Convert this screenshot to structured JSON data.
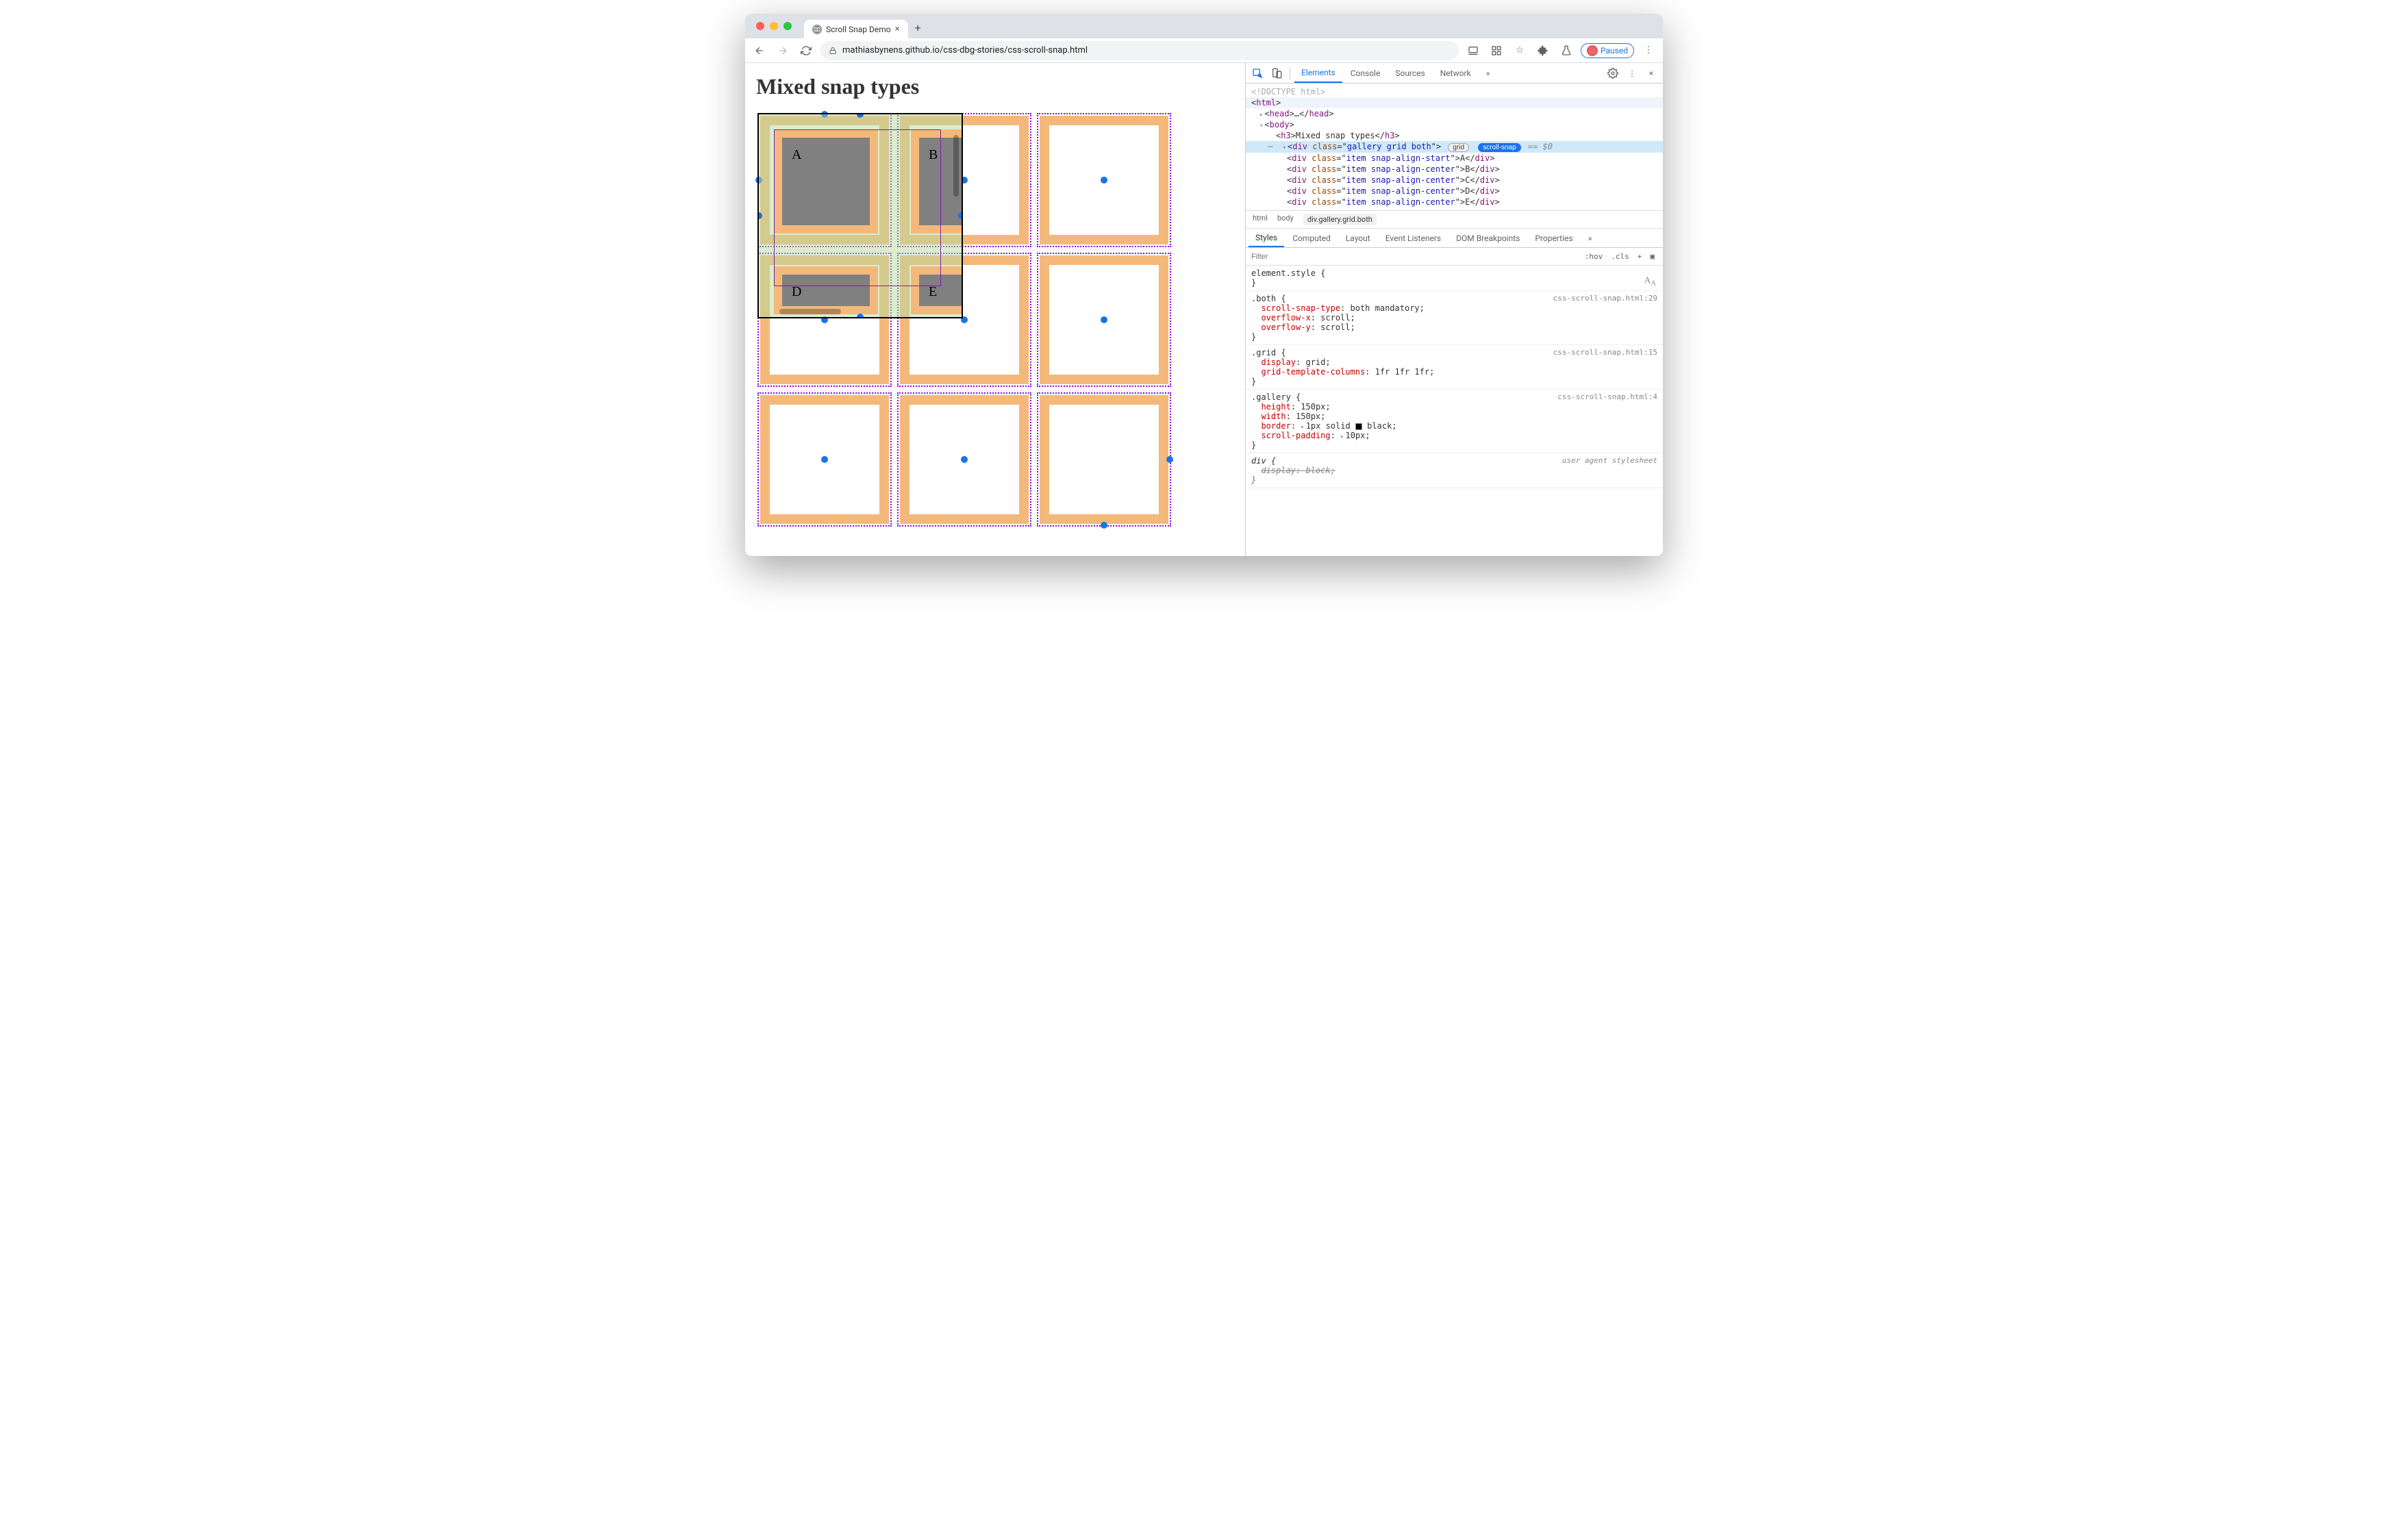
{
  "browser": {
    "tab_title": "Scroll Snap Demo",
    "url": "mathiasbynens.github.io/css-dbg-stories/css-scroll-snap.html",
    "paused_label": "Paused"
  },
  "page": {
    "heading": "Mixed snap types",
    "items": {
      "a": "A",
      "b": "B",
      "d": "D",
      "e": "E"
    }
  },
  "devtools": {
    "tabs": {
      "elements": "Elements",
      "console": "Console",
      "sources": "Sources",
      "network": "Network"
    },
    "dom": {
      "doctype": "<!DOCTYPE html>",
      "html_open": "html",
      "head": "head",
      "body": "body",
      "h3_text": "Mixed snap types",
      "selected_class": "gallery grid both",
      "badge_grid": "grid",
      "badge_snap": "scroll-snap",
      "eq0": "== $0",
      "items": [
        {
          "class": "item snap-align-start",
          "text": "A"
        },
        {
          "class": "item snap-align-center",
          "text": "B"
        },
        {
          "class": "item snap-align-center",
          "text": "C"
        },
        {
          "class": "item snap-align-center",
          "text": "D"
        },
        {
          "class": "item snap-align-center",
          "text": "E"
        }
      ]
    },
    "breadcrumb": {
      "html": "html",
      "body": "body",
      "active": "div.gallery.grid.both"
    },
    "subtabs": {
      "styles": "Styles",
      "computed": "Computed",
      "layout": "Layout",
      "event": "Event Listeners",
      "dom_bp": "DOM Breakpoints",
      "props": "Properties"
    },
    "filter": {
      "placeholder": "Filter",
      "hov": ":hov",
      "cls": ".cls"
    },
    "styles": {
      "element_style": "element.style {",
      "both": {
        "selector": ".both {",
        "source": "css-scroll-snap.html:29",
        "p1": "scroll-snap-type",
        "v1": "both mandatory",
        "p2": "overflow-x",
        "v2": "scroll",
        "p3": "overflow-y",
        "v3": "scroll"
      },
      "grid": {
        "selector": ".grid {",
        "source": "css-scroll-snap.html:15",
        "p1": "display",
        "v1": "grid",
        "p2": "grid-template-columns",
        "v2": "1fr 1fr 1fr"
      },
      "gallery": {
        "selector": ".gallery {",
        "source": "css-scroll-snap.html:4",
        "p1": "height",
        "v1": "150px",
        "p2": "width",
        "v2": "150px",
        "p3": "border",
        "v3": "1px solid ",
        "v3b": "black",
        "p4": "scroll-padding",
        "v4": "10px"
      },
      "div": {
        "selector": "div {",
        "source": "user agent stylesheet",
        "p1": "display",
        "v1": "block"
      },
      "close": "}"
    }
  }
}
